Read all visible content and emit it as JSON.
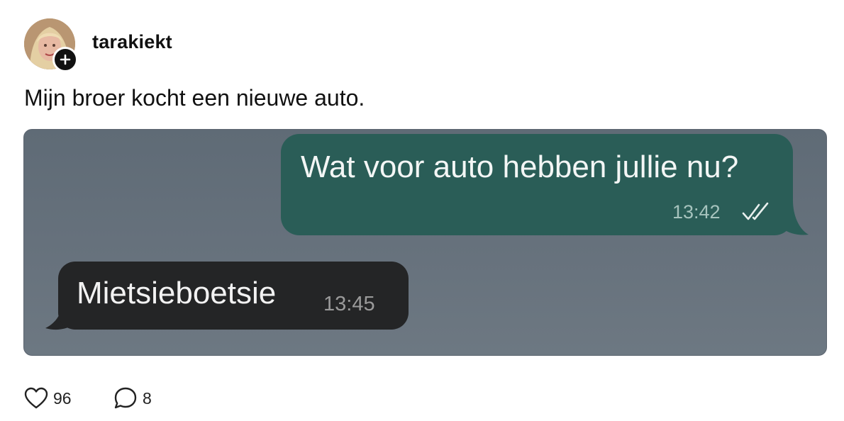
{
  "post": {
    "username": "tarakiekt",
    "text": "Mijn broer kocht een nieuwe auto.",
    "likes": "96",
    "comments": "8"
  },
  "chat": {
    "outgoing": {
      "text": "Wat voor auto hebben jullie nu?",
      "time": "13:42",
      "status": "double-check-icon",
      "color": "#2a5d57"
    },
    "incoming": {
      "text": "Mietsieboetsie",
      "time": "13:45",
      "color": "#242526"
    },
    "background_color": "#66717c"
  },
  "icons": {
    "follow": "plus-icon",
    "like": "heart-icon",
    "comment": "comment-bubble-icon"
  }
}
